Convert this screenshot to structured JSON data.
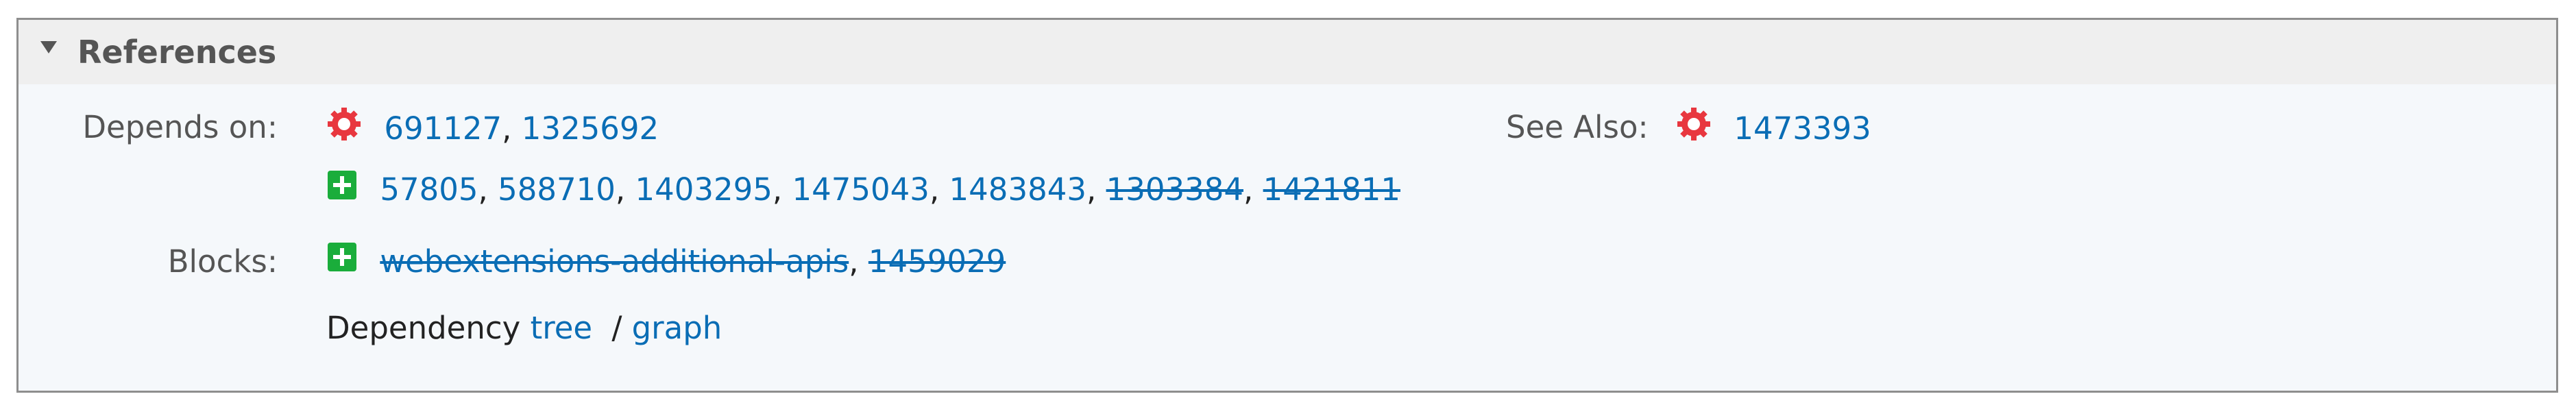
{
  "section": {
    "title": "References"
  },
  "depends_on": {
    "label": "Depends on:",
    "firefox_refs": [
      {
        "id": "691127",
        "resolved": false
      },
      {
        "id": "1325692",
        "resolved": false
      }
    ],
    "other_refs": [
      {
        "id": "57805",
        "resolved": false
      },
      {
        "id": "588710",
        "resolved": false
      },
      {
        "id": "1403295",
        "resolved": false
      },
      {
        "id": "1475043",
        "resolved": false
      },
      {
        "id": "1483843",
        "resolved": false
      },
      {
        "id": "1303384",
        "resolved": true
      },
      {
        "id": "1421811",
        "resolved": true
      }
    ]
  },
  "see_also": {
    "label": "See Also:",
    "refs": [
      {
        "id": "1473393",
        "resolved": false
      }
    ]
  },
  "blocks": {
    "label": "Blocks:",
    "refs": [
      {
        "id": "webextensions-additional-apis",
        "resolved": true
      },
      {
        "id": "1459029",
        "resolved": true
      }
    ]
  },
  "dependency": {
    "prefix": "Dependency",
    "tree_label": "tree",
    "separator": "/",
    "graph_label": "graph"
  },
  "colors": {
    "link": "#0a6db5",
    "firefox_icon": "#e8373f",
    "add_icon": "#1aad3b",
    "label": "#555555"
  },
  "icons": {
    "firefox_component": "gear-badge-icon",
    "other_component": "plus-square-icon"
  }
}
